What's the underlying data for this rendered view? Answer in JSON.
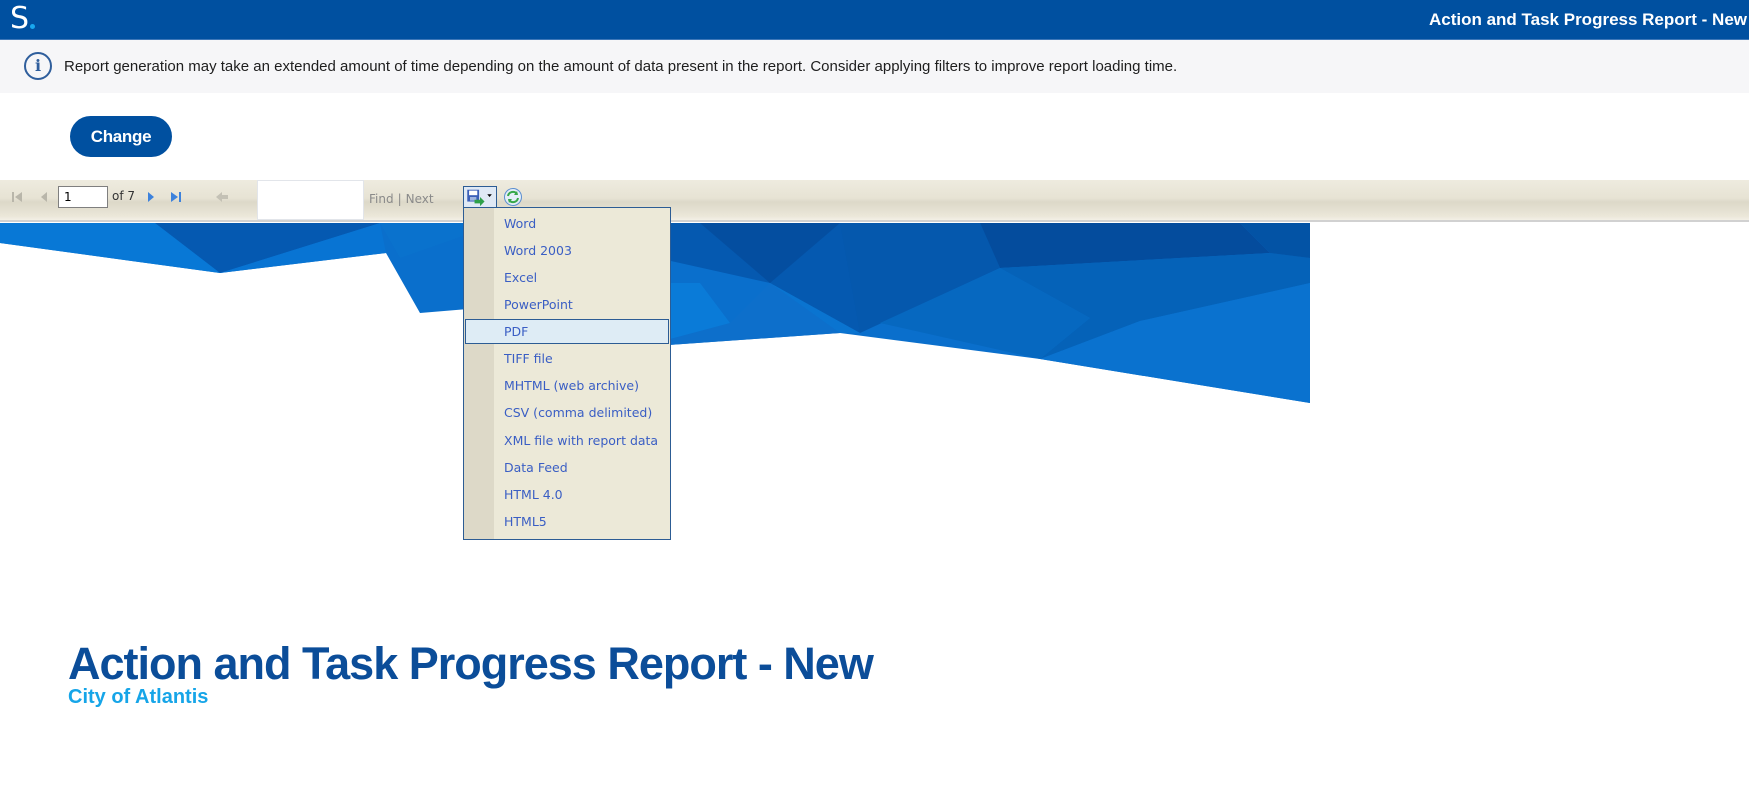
{
  "appbar": {
    "logo_text": "S",
    "title": "Action and Task Progress Report - New"
  },
  "info": {
    "icon": "info-icon",
    "message": "Report generation may take an extended amount of time depending on the amount of data present in the report. Consider applying filters to improve report loading time."
  },
  "actions": {
    "change_label": "Change"
  },
  "toolbar": {
    "current_page": "1",
    "of_label": "of 7",
    "find_value": "",
    "find_label": "Find",
    "separator": "|",
    "next_label": "Next",
    "icons": {
      "first": "first-page-icon",
      "prev": "previous-page-icon",
      "next": "next-page-icon",
      "last": "last-page-icon",
      "back": "back-to-parent-icon",
      "export": "export-icon",
      "refresh": "refresh-icon"
    }
  },
  "export_menu": {
    "highlighted": "PDF",
    "items": [
      {
        "label": "Word"
      },
      {
        "label": "Word 2003"
      },
      {
        "label": "Excel"
      },
      {
        "label": "PowerPoint"
      },
      {
        "label": "PDF"
      },
      {
        "label": "TIFF file"
      },
      {
        "label": "MHTML (web archive)"
      },
      {
        "label": "CSV (comma delimited)"
      },
      {
        "label": "XML file with report data"
      },
      {
        "label": "Data Feed"
      },
      {
        "label": "HTML 4.0"
      },
      {
        "label": "HTML5"
      }
    ]
  },
  "report": {
    "title": "Action and Task Progress Report - New",
    "subtitle": "City of Atlantis"
  },
  "colors": {
    "brand_blue": "#0050a0",
    "title_blue": "#0b4d99",
    "subtitle_blue": "#16a5e8",
    "menu_text": "#3a5ec4",
    "toolbar_bg": "#e7e3d4"
  }
}
